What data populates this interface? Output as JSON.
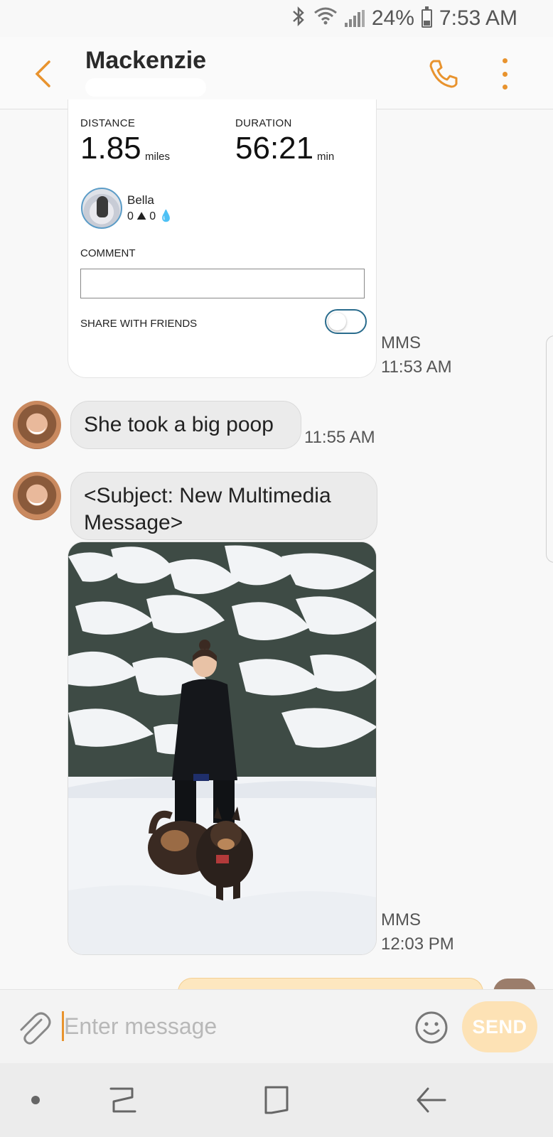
{
  "status_bar": {
    "battery": "24%",
    "time": "7:53 AM",
    "icons": [
      "bluetooth-icon",
      "wifi-icon",
      "signal-icon",
      "battery-icon"
    ]
  },
  "header": {
    "contact_name": "Mackenzie",
    "icons": [
      "back-arrow-icon",
      "phone-icon",
      "more-vert-icon"
    ],
    "accent_color": "#e8932e"
  },
  "activity_card": {
    "distance_label": "DISTANCE",
    "distance_value": "1.85",
    "distance_unit": "miles",
    "duration_label": "DURATION",
    "duration_value": "56:21",
    "duration_unit": "min",
    "dog_name": "Bella",
    "dog_stats": "0 ⛰ 0 💧",
    "comment_label": "COMMENT",
    "share_label": "SHARE WITH FRIENDS",
    "share_enabled": false
  },
  "messages": [
    {
      "type": "mms-card",
      "meta_type": "MMS",
      "time": "11:53 AM"
    },
    {
      "type": "text",
      "text": "She took a big poop",
      "time": "11:55 AM"
    },
    {
      "type": "mms-photo",
      "subject": "<Subject: New Multimedia Message>",
      "meta_type": "MMS",
      "time": "12:03 PM"
    }
  ],
  "composer": {
    "placeholder": "Enter message",
    "send_label": "SEND",
    "icons": [
      "attach-icon",
      "emoji-icon"
    ]
  },
  "nav_bar": {
    "icons": [
      "dot-icon",
      "recents-icon",
      "home-icon",
      "back-icon"
    ]
  }
}
